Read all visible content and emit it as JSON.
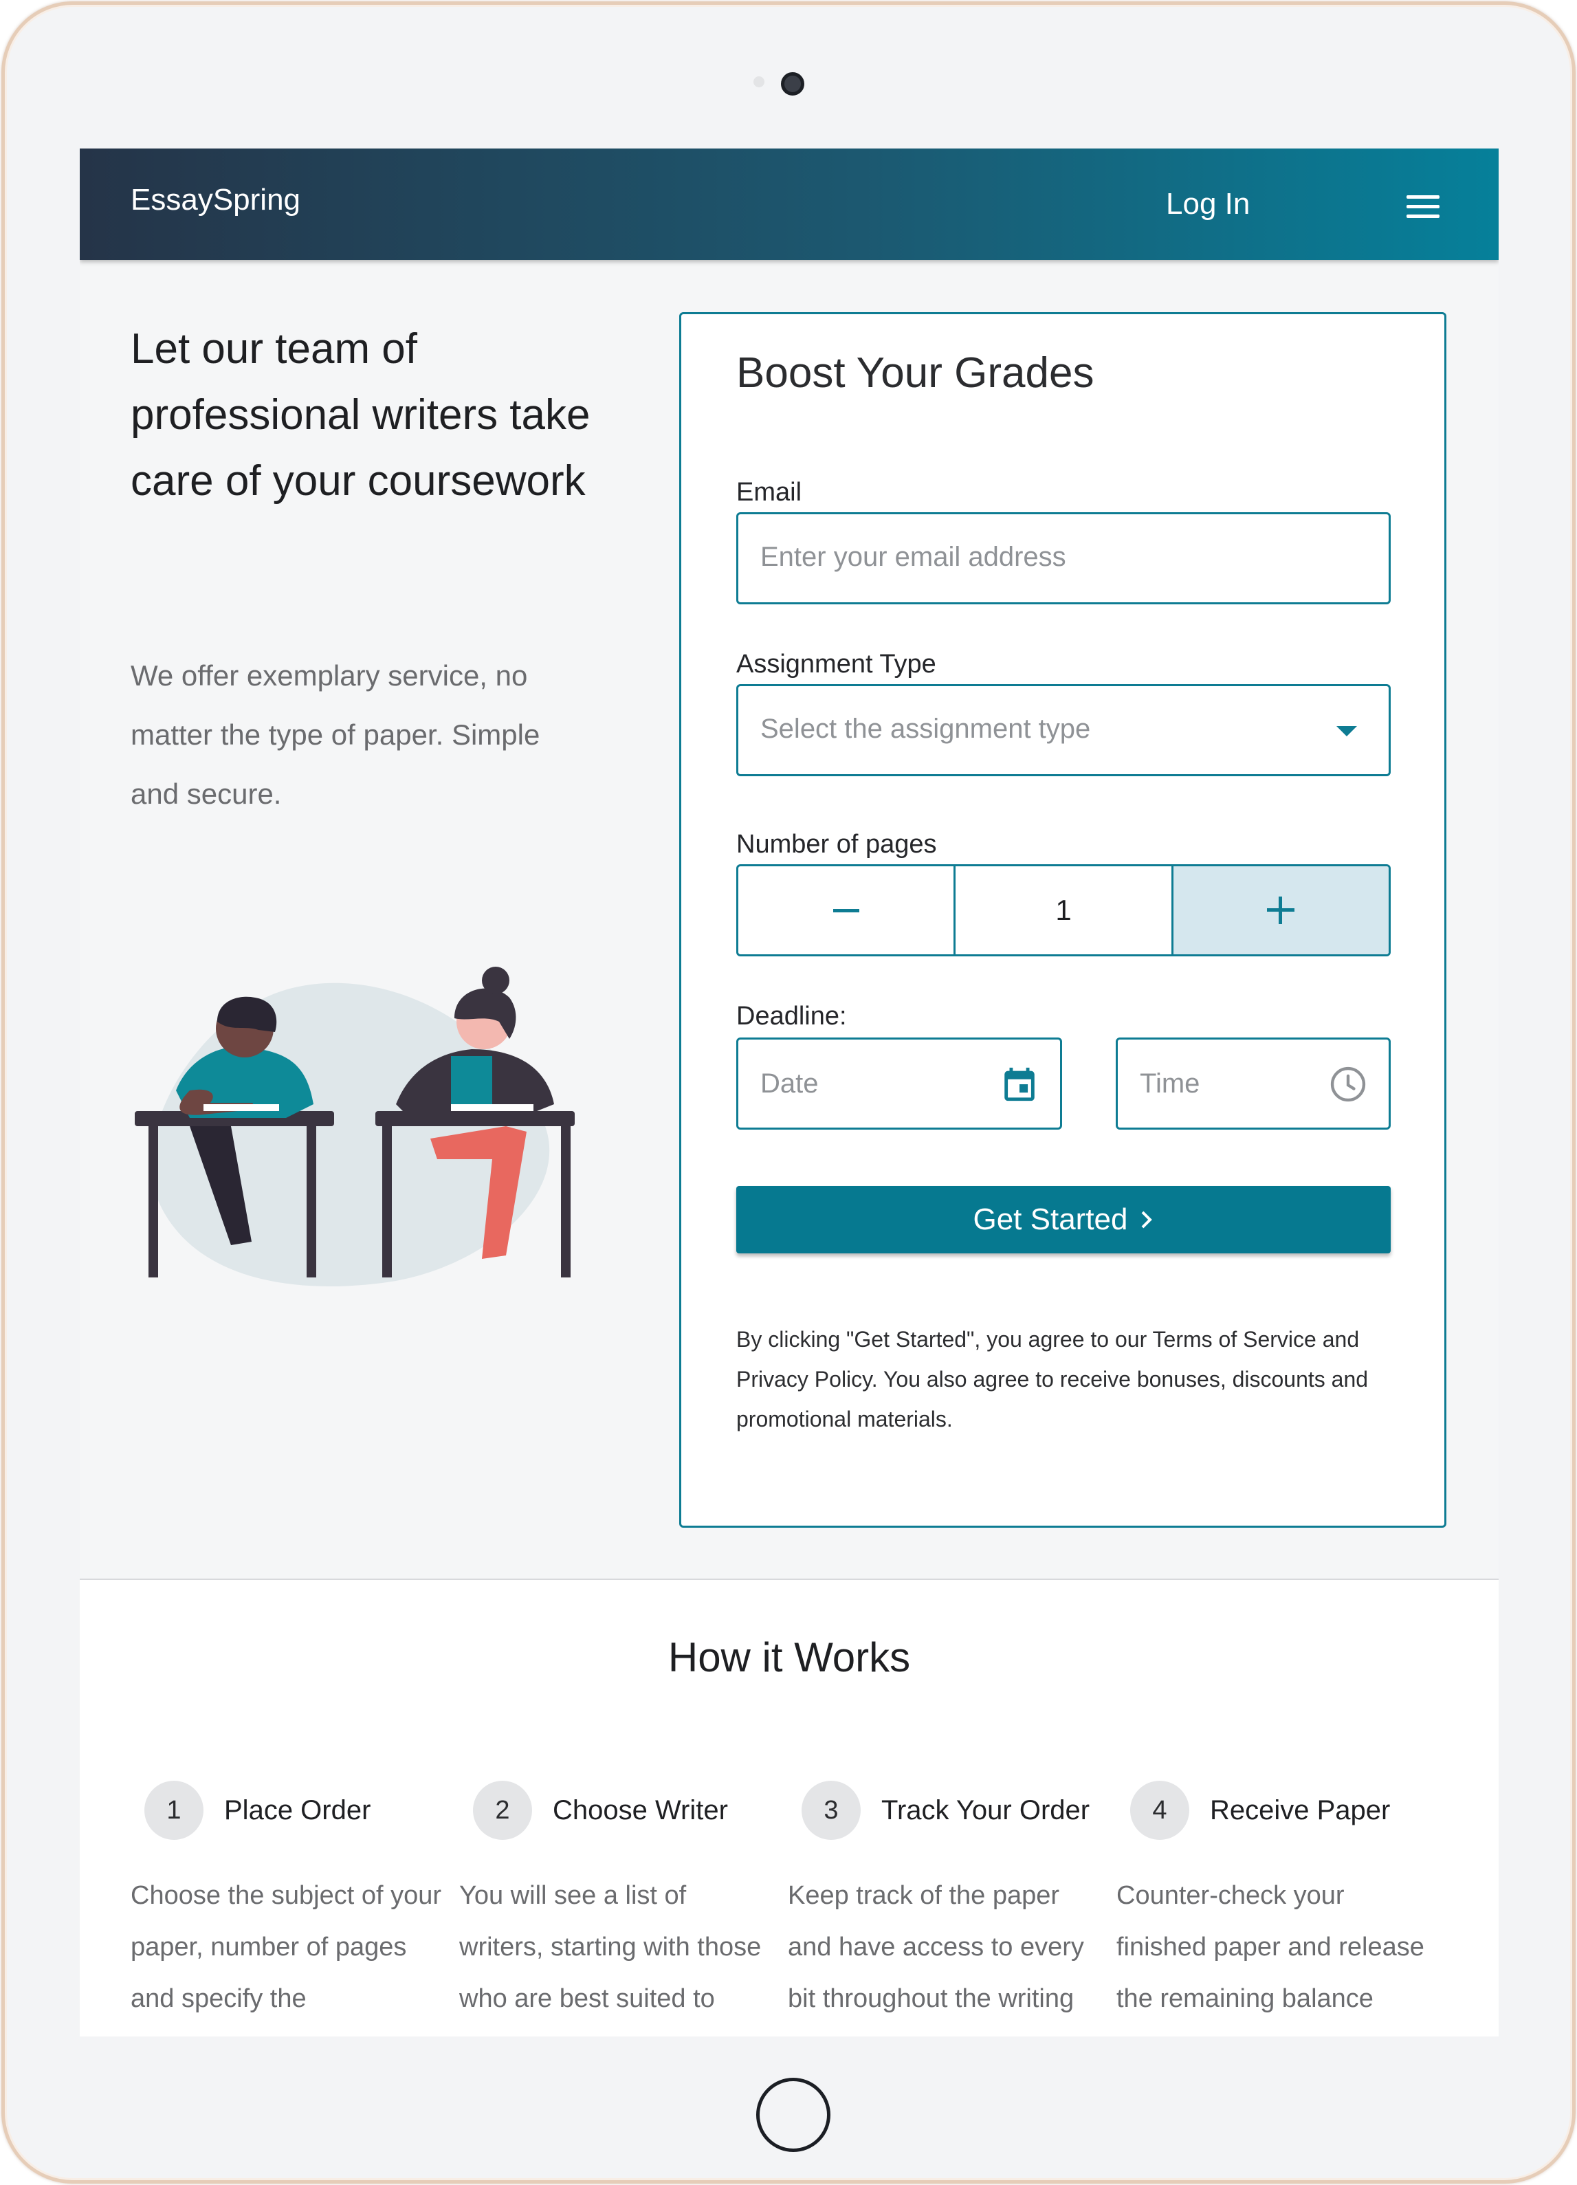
{
  "brand": "EssaySpring",
  "nav": {
    "login": "Log In"
  },
  "hero": {
    "title": "Let our team of professional writers take care of your coursework",
    "subtitle": "We offer exemplary service, no matter the type of paper. Simple and secure."
  },
  "form": {
    "title": "Boost Your Grades",
    "email_label": "Email",
    "email_placeholder": "Enter your email address",
    "assignment_label": "Assignment Type",
    "assignment_placeholder": "Select the assignment type",
    "pages_label": "Number of pages",
    "pages_value": "1",
    "deadline_label": "Deadline:",
    "date_placeholder": "Date",
    "time_placeholder": "Time",
    "cta": "Get Started",
    "terms": "By clicking \"Get Started\", you agree to our Terms of Service and Privacy Policy. You also agree to receive bonuses, discounts and promotional materials."
  },
  "how": {
    "title": "How it Works",
    "steps": [
      {
        "num": "1",
        "name": "Place Order",
        "desc": "Choose the subject of your paper, number of pages and specify the"
      },
      {
        "num": "2",
        "name": "Choose Writer",
        "desc": "You will see a list of writers, starting with those who are best suited to"
      },
      {
        "num": "3",
        "name": "Track Your Order",
        "desc": "Keep track of the paper and have access to every bit throughout the writing"
      },
      {
        "num": "4",
        "name": "Receive Paper",
        "desc": "Counter-check your finished paper and release the remaining balance"
      }
    ]
  },
  "colors": {
    "accent": "#067990",
    "header_start": "#253448",
    "header_end": "#06809a"
  },
  "icons": [
    "menu-icon",
    "chevron-down-icon",
    "minus-icon",
    "plus-icon",
    "calendar-icon",
    "clock-icon",
    "chevron-right-icon"
  ]
}
